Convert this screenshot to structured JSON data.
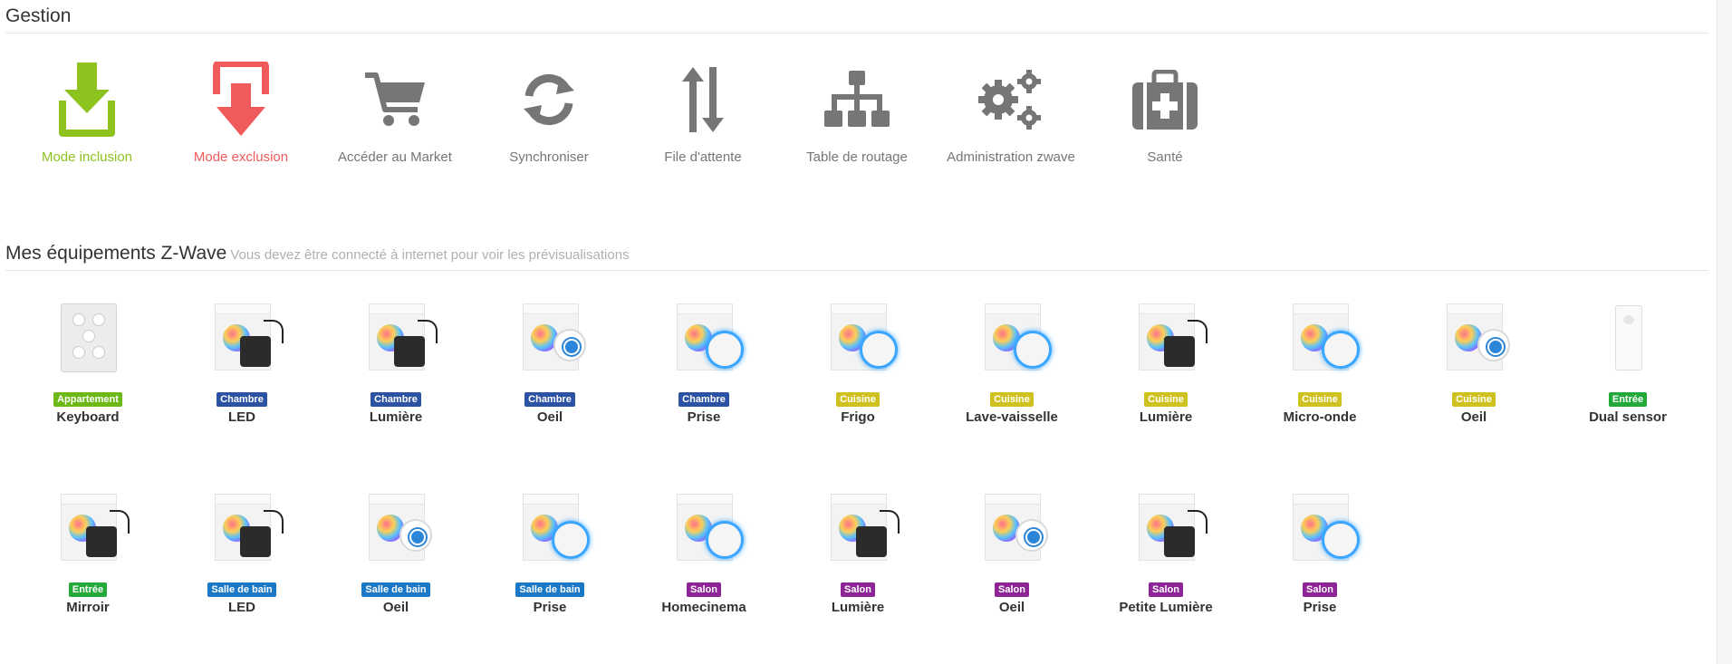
{
  "gestion": {
    "title": "Gestion",
    "actions": [
      {
        "label": "Mode inclusion",
        "icon": "download-tray-icon",
        "color": "#8dc21f"
      },
      {
        "label": "Mode exclusion",
        "icon": "upload-tray-icon",
        "color": "#f05a5b"
      },
      {
        "label": "Accéder au Market",
        "icon": "shopping-cart-icon",
        "color": "#767676"
      },
      {
        "label": "Synchroniser",
        "icon": "sync-icon",
        "color": "#767676"
      },
      {
        "label": "File d'attente",
        "icon": "sort-arrows-icon",
        "color": "#767676"
      },
      {
        "label": "Table de routage",
        "icon": "sitemap-icon",
        "color": "#767676"
      },
      {
        "label": "Administration zwave",
        "icon": "gears-icon",
        "color": "#767676"
      },
      {
        "label": "Santé",
        "icon": "medkit-icon",
        "color": "#767676"
      }
    ]
  },
  "equipements": {
    "title": "Mes équipements Z-Wave",
    "subtitle": "Vous devez être connecté à internet pour voir les prévisualisations",
    "devices": [
      {
        "room": "Appartement",
        "name": "Keyboard",
        "color": "#6cb817",
        "kind": "keypad"
      },
      {
        "room": "Chambre",
        "name": "LED",
        "color": "#2c52a4",
        "kind": "rgbw"
      },
      {
        "room": "Chambre",
        "name": "Lumière",
        "color": "#2c52a4",
        "kind": "dimmer"
      },
      {
        "room": "Chambre",
        "name": "Oeil",
        "color": "#2c52a4",
        "kind": "eye"
      },
      {
        "room": "Chambre",
        "name": "Prise",
        "color": "#2c52a4",
        "kind": "plug"
      },
      {
        "room": "Cuisine",
        "name": "Frigo",
        "color": "#cfc11f",
        "kind": "plug"
      },
      {
        "room": "Cuisine",
        "name": "Lave-vaisselle",
        "color": "#cfc11f",
        "kind": "plug"
      },
      {
        "room": "Cuisine",
        "name": "Lumière",
        "color": "#cfc11f",
        "kind": "dimmer"
      },
      {
        "room": "Cuisine",
        "name": "Micro-onde",
        "color": "#cfc11f",
        "kind": "plug"
      },
      {
        "room": "Cuisine",
        "name": "Oeil",
        "color": "#cfc11f",
        "kind": "eye"
      },
      {
        "room": "Entrée",
        "name": "Dual sensor",
        "color": "#22a93a",
        "kind": "pir"
      },
      {
        "room": "Entrée",
        "name": "Mirroir",
        "color": "#22a93a",
        "kind": "rgbw"
      },
      {
        "room": "Salle de bain",
        "name": "LED",
        "color": "#1a78c6",
        "kind": "rgbw"
      },
      {
        "room": "Salle de bain",
        "name": "Oeil",
        "color": "#1a78c6",
        "kind": "eye"
      },
      {
        "room": "Salle de bain",
        "name": "Prise",
        "color": "#1a78c6",
        "kind": "plug"
      },
      {
        "room": "Salon",
        "name": "Homecinema",
        "color": "#8e2596",
        "kind": "plug"
      },
      {
        "room": "Salon",
        "name": "Lumière",
        "color": "#8e2596",
        "kind": "dimmer"
      },
      {
        "room": "Salon",
        "name": "Oeil",
        "color": "#8e2596",
        "kind": "eye"
      },
      {
        "room": "Salon",
        "name": "Petite Lumière",
        "color": "#8e2596",
        "kind": "dimmer"
      },
      {
        "room": "Salon",
        "name": "Prise",
        "color": "#8e2596",
        "kind": "plug"
      }
    ]
  }
}
